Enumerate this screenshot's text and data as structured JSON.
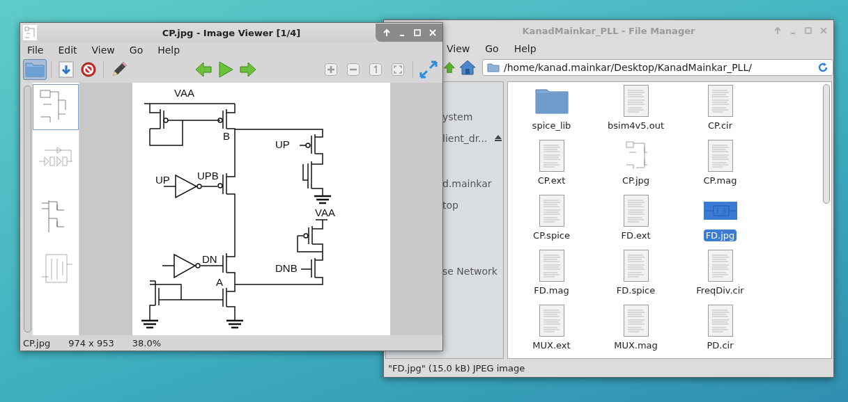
{
  "image_viewer": {
    "title": "CP.jpg - Image Viewer [1/4]",
    "menu": [
      "File",
      "Edit",
      "View",
      "Go",
      "Help"
    ],
    "toolbar": [
      {
        "kind": "open",
        "pressed": true
      },
      {
        "kind": "save",
        "pressed": false
      },
      {
        "kind": "delete",
        "pressed": false
      },
      {
        "kind": "edit",
        "pressed": false
      },
      {
        "kind": "prev",
        "pressed": false
      },
      {
        "kind": "play",
        "pressed": false
      },
      {
        "kind": "next",
        "pressed": false
      },
      {
        "kind": "zoom-in",
        "pressed": false
      },
      {
        "kind": "zoom-out",
        "pressed": false
      },
      {
        "kind": "original",
        "pressed": false
      },
      {
        "kind": "fit",
        "pressed": false
      },
      {
        "kind": "fullscreen",
        "pressed": false
      }
    ],
    "thumbnails": [
      {
        "selected": true
      },
      {
        "selected": false
      },
      {
        "selected": false
      },
      {
        "selected": false
      }
    ],
    "schematic_labels": [
      "VAA",
      "B",
      "UP",
      "UPB",
      "UP",
      "DN",
      "A",
      "VAA",
      "DNB"
    ],
    "status": [
      "CP.jpg",
      "974 x 953",
      "38.0%"
    ]
  },
  "file_manager": {
    "title": "KanadMainkar_PLL - File Manager",
    "menu": [
      "View",
      "Go",
      "Help"
    ],
    "path": "/home/kanad.mainkar/Desktop/KanadMainkar_PLL/",
    "sidebar": [
      {
        "label": "ystem",
        "eject": false
      },
      {
        "label": "lient_dr...",
        "eject": true
      },
      {
        "label": "d.mainkar",
        "eject": false
      },
      {
        "label": "top",
        "eject": false
      },
      {
        "label": "se Network",
        "eject": false
      }
    ],
    "files": [
      {
        "name": "spice_lib",
        "kind": "folder",
        "selected": false
      },
      {
        "name": "bsim4v5.out",
        "kind": "document",
        "selected": false
      },
      {
        "name": "CP.cir",
        "kind": "document",
        "selected": false
      },
      {
        "name": "CP.ext",
        "kind": "document",
        "selected": false
      },
      {
        "name": "CP.jpg",
        "kind": "image",
        "selected": false
      },
      {
        "name": "CP.mag",
        "kind": "document",
        "selected": false
      },
      {
        "name": "CP.spice",
        "kind": "document",
        "selected": false
      },
      {
        "name": "FD.ext",
        "kind": "document",
        "selected": false
      },
      {
        "name": "FD.jpg",
        "kind": "image",
        "selected": true
      },
      {
        "name": "FD.mag",
        "kind": "document",
        "selected": false
      },
      {
        "name": "FD.spice",
        "kind": "document",
        "selected": false
      },
      {
        "name": "FreqDiv.cir",
        "kind": "document",
        "selected": false
      },
      {
        "name": "MUX.ext",
        "kind": "document",
        "selected": false
      },
      {
        "name": "MUX.mag",
        "kind": "document",
        "selected": false
      },
      {
        "name": "PD.cir",
        "kind": "document",
        "selected": false
      }
    ],
    "status": "\"FD.jpg\" (15.0 kB) JPEG image"
  }
}
